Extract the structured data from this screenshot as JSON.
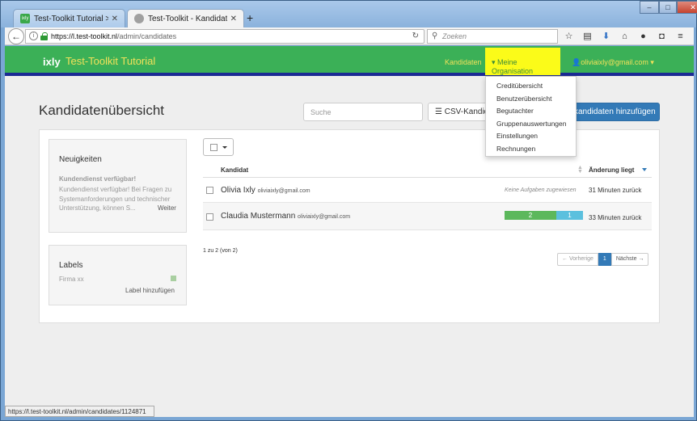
{
  "browser": {
    "tabs": [
      {
        "label": "Test-Toolkit Tutorial > Ixly",
        "favicon": "ixly"
      },
      {
        "label": "Test-Toolkit - Kandidatenü...",
        "favicon": "globe"
      }
    ],
    "new_tab": "+",
    "window_controls": {
      "minimize": "–",
      "maximize": "□",
      "close": "✕"
    },
    "url_host": "https://l.test-toolkit.nl",
    "url_path": "/admin/candidates",
    "search_placeholder": "Zoeken",
    "status_url": "https://l.test-toolkit.nl/admin/candidates/1124871"
  },
  "app": {
    "logo": "ixly",
    "brand": "Test-Toolkit Tutorial",
    "nav": {
      "candidates": "Kandidaten",
      "organisation": "▾ Meine Organisation",
      "user": "oliviaixly@gmail.com ▾"
    },
    "org_menu": [
      "Creditübersicht",
      "Benutzerübersicht",
      "Begutachter",
      "Gruppenauswertungen",
      "Einstellungen",
      "Rechnungen"
    ]
  },
  "page": {
    "title": "Kandidatenübersicht",
    "search_placeholder": "Suche",
    "csv_button": "CSV-Kandid",
    "add_button": "kandidaten hinzufügen"
  },
  "news": {
    "heading": "Neuigkeiten",
    "subheading": "Kundendienst verfügbar!",
    "body": "Kundendienst verfügbar! Bei Fragen zu Systemanforderungen und technischer Unterstützung, können S...",
    "more": "Weiter"
  },
  "labels": {
    "heading": "Labels",
    "items": [
      {
        "name": "Firma xx",
        "color": "#a9cfa1"
      }
    ],
    "add": "Label hinzufügen"
  },
  "table": {
    "col_candidate": "Kandidat",
    "col_changed": "Änderung liegt",
    "rows": [
      {
        "name": "Olivia Ixly",
        "email": "oliviaixly@gmail.com",
        "status_text": "Keine Aufgaben zugewiesen",
        "changed": "31 Minuten zurück"
      },
      {
        "name": "Claudia Mustermann",
        "email": "oliviaixly@gmail.com",
        "progress_done": "2",
        "progress_open": "1",
        "changed": "33 Minuten zurück"
      }
    ],
    "count": "1 zu 2 (von 2)",
    "pager": {
      "prev": "← Vorherige",
      "current": "1",
      "next": "Nächste →"
    }
  },
  "colors": {
    "appbar": "#3bb057",
    "accent": "#337ab7",
    "highlight": "#fbfb19"
  }
}
